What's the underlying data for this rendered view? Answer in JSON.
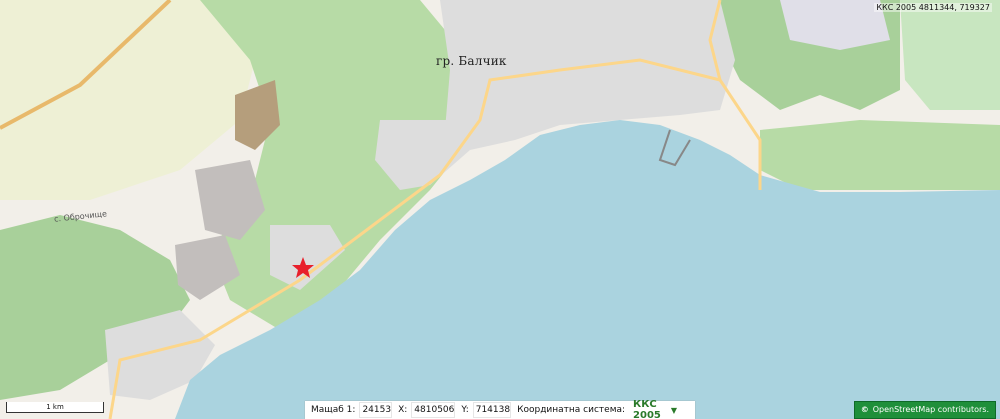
{
  "map": {
    "town_label": "гр. Балчик",
    "village_label": "с. Оброчище",
    "marker_icon": "red-star-marker",
    "colors": {
      "sea": "#aad3df",
      "forest": "#a8d09a",
      "land": "#f2efe9",
      "farmland": "#eef0d5",
      "urban": "#dddddd",
      "quarry": "#c2bebc",
      "road": "#fcd68a",
      "marker": "#e8202c"
    }
  },
  "cursor_coords": "ККС 2005 4811344, 719327",
  "scale": {
    "label": "1 km"
  },
  "status": {
    "scale_label": "Мащаб 1:",
    "scale_value": "24153",
    "x_label": "X:",
    "x_value": "4810506",
    "y_label": "Y:",
    "y_value": "714138",
    "system_label": "Координатна система:",
    "system_value": "ККС 2005",
    "dropdown_glyph": "▼",
    "search_icon": "search-icon"
  },
  "attribution": {
    "symbol": "©",
    "text": "OpenStreetMap contributors."
  }
}
